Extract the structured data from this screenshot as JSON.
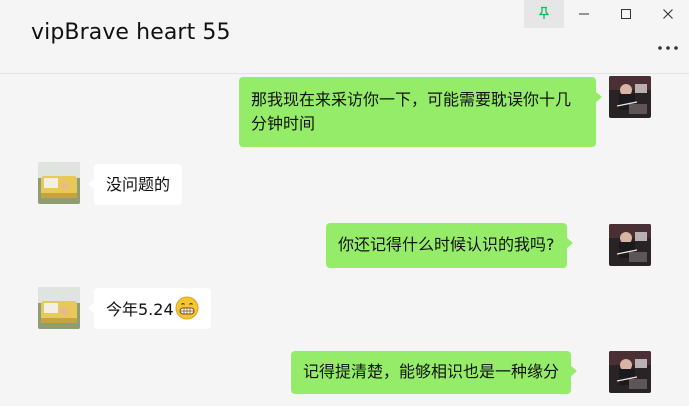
{
  "window": {
    "title": "vipBrave heart 55",
    "controls": [
      "pin-icon",
      "minimize-icon",
      "maximize-icon",
      "close-icon"
    ],
    "more_icon": "more-dots-icon"
  },
  "colors": {
    "background": "#f5f5f5",
    "my_bubble": "#95ec69",
    "other_bubble": "#ffffff",
    "pin_active": "#07c160"
  },
  "messages": [
    {
      "sender": "me",
      "text": "那我现在来采访你一下，可能需要耽误你十几分钟时间"
    },
    {
      "sender": "other",
      "text": "没问题的"
    },
    {
      "sender": "me",
      "text": "你还记得什么时候认识的我吗?"
    },
    {
      "sender": "other",
      "text": "今年5.24",
      "emoji": "grinning-face-emoji"
    },
    {
      "sender": "me",
      "text": "记得提清楚，能够相识也是一种缘分"
    }
  ]
}
